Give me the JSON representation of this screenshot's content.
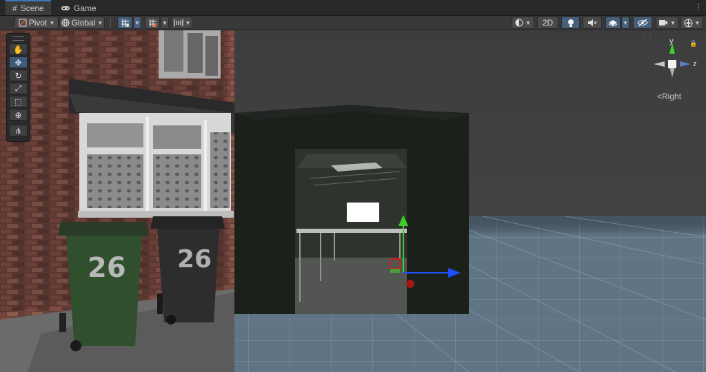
{
  "tabs": [
    {
      "label": "Scene",
      "icon": "grid-icon",
      "active": true
    },
    {
      "label": "Game",
      "icon": "gamepad-icon",
      "active": false
    }
  ],
  "toolbar": {
    "pivot_label": "Pivot",
    "global_label": "Global",
    "mode_2d_label": "2D"
  },
  "scene_tools": [
    "hand-tool",
    "move-tool",
    "rotate-tool",
    "scale-tool",
    "rect-tool",
    "transform-tool",
    "custom-tool"
  ],
  "orientation_gizmo": {
    "view_label": "Right",
    "axis_y": "y",
    "axis_z": "z"
  },
  "bins": [
    {
      "number": "26",
      "color": "#2f4f2d"
    },
    {
      "number": "26",
      "color": "#2d2d2d"
    }
  ],
  "colors": {
    "accent": "#3a79bb",
    "x_axis": "#1f4fff",
    "y_axis": "#3ccf2a",
    "z_axis": "#c81e1e"
  }
}
